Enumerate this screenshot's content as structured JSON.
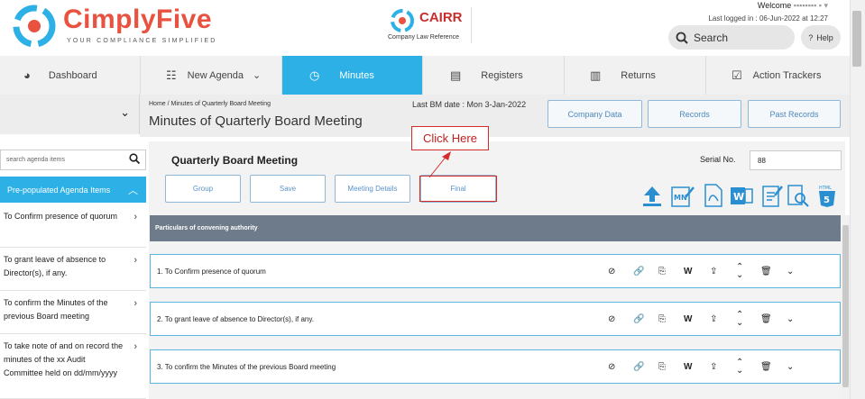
{
  "header": {
    "logo": "CimplyFive",
    "logo_tagline": "YOUR COMPLIANCE SIMPLIFIED",
    "cairr": "CAIRR",
    "cairr_sub": "Company Law Reference",
    "welcome": "Welcome",
    "last_logged": "Last logged in : 06-Jun-2022 at 12:27",
    "search_label": "Search",
    "help_label": "Help"
  },
  "nav": [
    {
      "label": "Dashboard",
      "icon": "gauge-icon"
    },
    {
      "label": "New Agenda",
      "icon": "list-icon"
    },
    {
      "label": "Minutes",
      "icon": "clock-icon"
    },
    {
      "label": "Registers",
      "icon": "register-icon"
    },
    {
      "label": "Returns",
      "icon": "document-icon"
    },
    {
      "label": "Action Trackers",
      "icon": "checklist-icon"
    }
  ],
  "breadcrumb": "Home  /  Minutes of Quarterly Board Meeting",
  "page_title": "Minutes of Quarterly Board Meeting",
  "bm_date": "Last BM date : Mon 3-Jan-2022",
  "top_buttons": [
    "Company Data",
    "Records",
    "Past Records"
  ],
  "sidebar": {
    "search_placeholder": "search agenda items",
    "prepop_label": "Pre-populated Agenda Items",
    "items": [
      "To Confirm presence of quorum",
      "To grant leave of absence to Director(s), if any.",
      "To confirm the Minutes of the previous Board meeting",
      "To take note of and on record the minutes of the xx Audit Committee held on dd/mm/yyyy"
    ]
  },
  "main": {
    "meeting_title": "Quarterly Board Meeting",
    "serial_label": "Serial No.",
    "serial_value": "88",
    "buttons": [
      "Group",
      "Save",
      "Meeting Details",
      "Final"
    ],
    "callout": "Click Here",
    "particulars": "Particulars of convening authority",
    "rows": [
      "1.   To Confirm presence of quorum",
      "2.   To grant leave of absence to Director(s), if any.",
      "3.   To confirm the Minutes of the previous Board meeting"
    ]
  },
  "colors": {
    "accent": "#2cb0e6",
    "brand": "#e8523f",
    "callout": "#d62b2b"
  }
}
